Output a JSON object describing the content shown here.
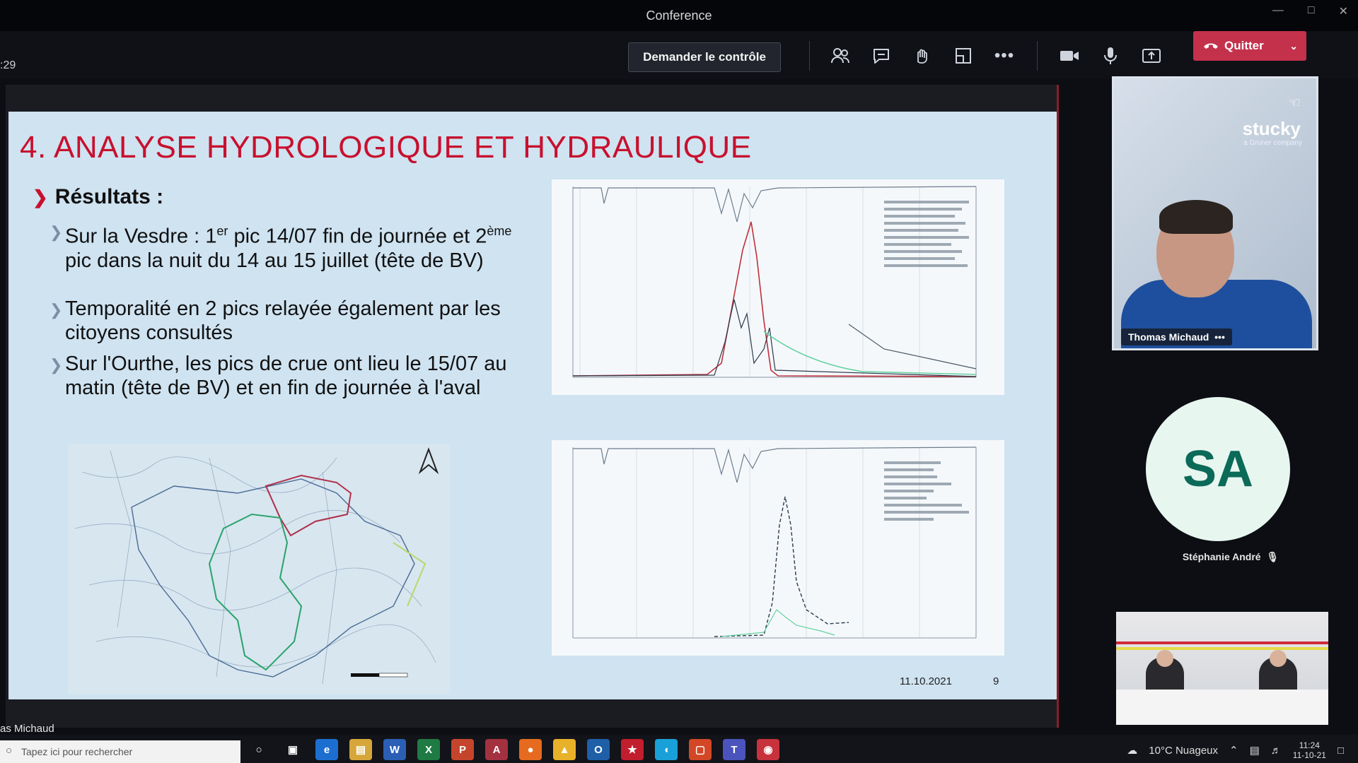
{
  "window": {
    "title": "Conference"
  },
  "toolbar": {
    "timer": ":29",
    "request_control": "Demander le contrôle",
    "leave": "Quitter"
  },
  "icons": {
    "participants": "people-icon",
    "chat": "chat-bubble-icon",
    "reactions": "hand-icon",
    "rooms": "breakout-icon",
    "more": "more-icon",
    "camera": "camera-icon",
    "mic": "microphone-icon",
    "share": "share-icon"
  },
  "slide": {
    "title": "4. ANALYSE HYDROLOGIQUE ET HYDRAULIQUE",
    "section": "Résultats :",
    "bullets": [
      {
        "pre": "Sur la Vesdre : 1",
        "sup1": "er",
        "mid": " pic 14/07 fin de journée et 2",
        "sup2": "ème",
        "post": " pic dans la nuit du 14 au 15 juillet (tête de BV)"
      },
      {
        "text": "Temporalité en 2 pics relayée également par les citoyens consultés"
      },
      {
        "text": "Sur l'Ourthe, les pics de crue ont lieu le 15/07 au matin (tête de BV) et en fin de journée à l'aval"
      }
    ],
    "date": "11.10.2021",
    "page_number": "9"
  },
  "presenter_label": "as Michaud",
  "participants": [
    {
      "name": "Thomas Michaud",
      "brand": "stucky",
      "brand_sub": "a Gruner company"
    },
    {
      "initials": "SA",
      "name": "Stéphanie André"
    }
  ],
  "taskbar": {
    "search_placeholder": "Tapez ici pour rechercher",
    "weather": "10°C Nuageux",
    "time": "11:24",
    "date": "11-10-21"
  },
  "colors": {
    "title_red": "#c8102e",
    "leave_red": "#c4314b",
    "avatar_bg": "#e8f6f0",
    "avatar_text": "#0b6a58",
    "slide_bg": "#cfe3f1"
  }
}
